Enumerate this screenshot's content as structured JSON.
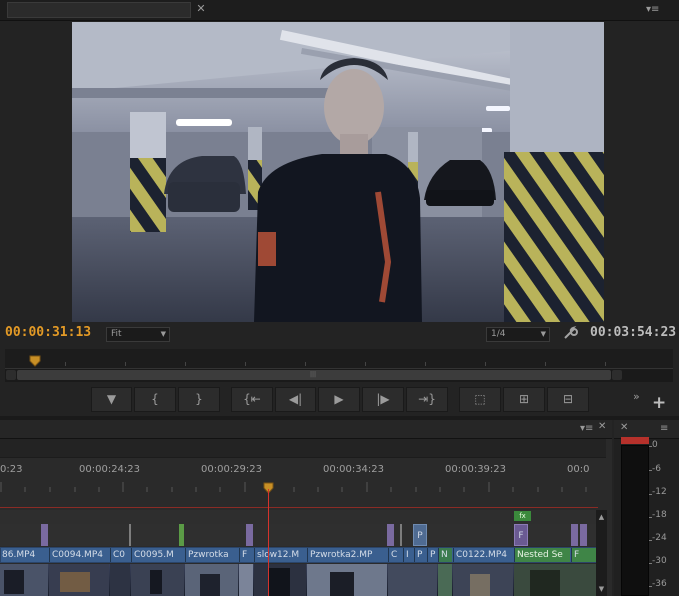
{
  "program_monitor": {
    "current_timecode": "00:00:31:13",
    "duration_timecode": "00:03:54:23",
    "zoom": {
      "selected": "Fit"
    },
    "resolution": {
      "selected": "1/4"
    },
    "controls": {
      "add_marker": "add-marker-icon",
      "mark_in": "mark-in-icon",
      "mark_out": "mark-out-icon",
      "go_to_in": "go-to-in-icon",
      "step_back": "step-back-icon",
      "play": "play-icon",
      "step_forward": "step-forward-icon",
      "go_to_out": "go-to-out-icon",
      "lift": "lift-icon",
      "extract": "extract-icon",
      "export_frame": "export-frame-icon"
    }
  },
  "timeline": {
    "ruler_labels": [
      "0:23",
      "00:00:24:23",
      "00:00:29:23",
      "00:00:34:23",
      "00:00:39:23",
      "00:0"
    ],
    "clips": [
      {
        "label": "86.MP4"
      },
      {
        "label": "C0094.MP4"
      },
      {
        "label": "C0"
      },
      {
        "label": "C0095.M"
      },
      {
        "label": "Pzwrotka"
      },
      {
        "label": "F"
      },
      {
        "label": "slow12.M"
      },
      {
        "label": "Pzwrotka2.MP"
      },
      {
        "label": "C"
      },
      {
        "label": "I"
      },
      {
        "label": "P"
      },
      {
        "label": "P"
      },
      {
        "label": "N"
      },
      {
        "label": "C0122.MP4"
      },
      {
        "label": "Nested Se"
      },
      {
        "label": "F"
      }
    ],
    "track_markers": [
      {
        "label": "P"
      },
      {
        "label": "F"
      }
    ],
    "green_tag": "fx"
  },
  "audio_meter": {
    "scale": [
      "0",
      "-6",
      "-12",
      "-18",
      "-24",
      "-30",
      "-36"
    ],
    "peak_color": "#b6312b"
  },
  "theme": {
    "accent_timecode": "#e39a26",
    "playhead": "#d5332c",
    "clip_blue": "#3a5f8f"
  }
}
